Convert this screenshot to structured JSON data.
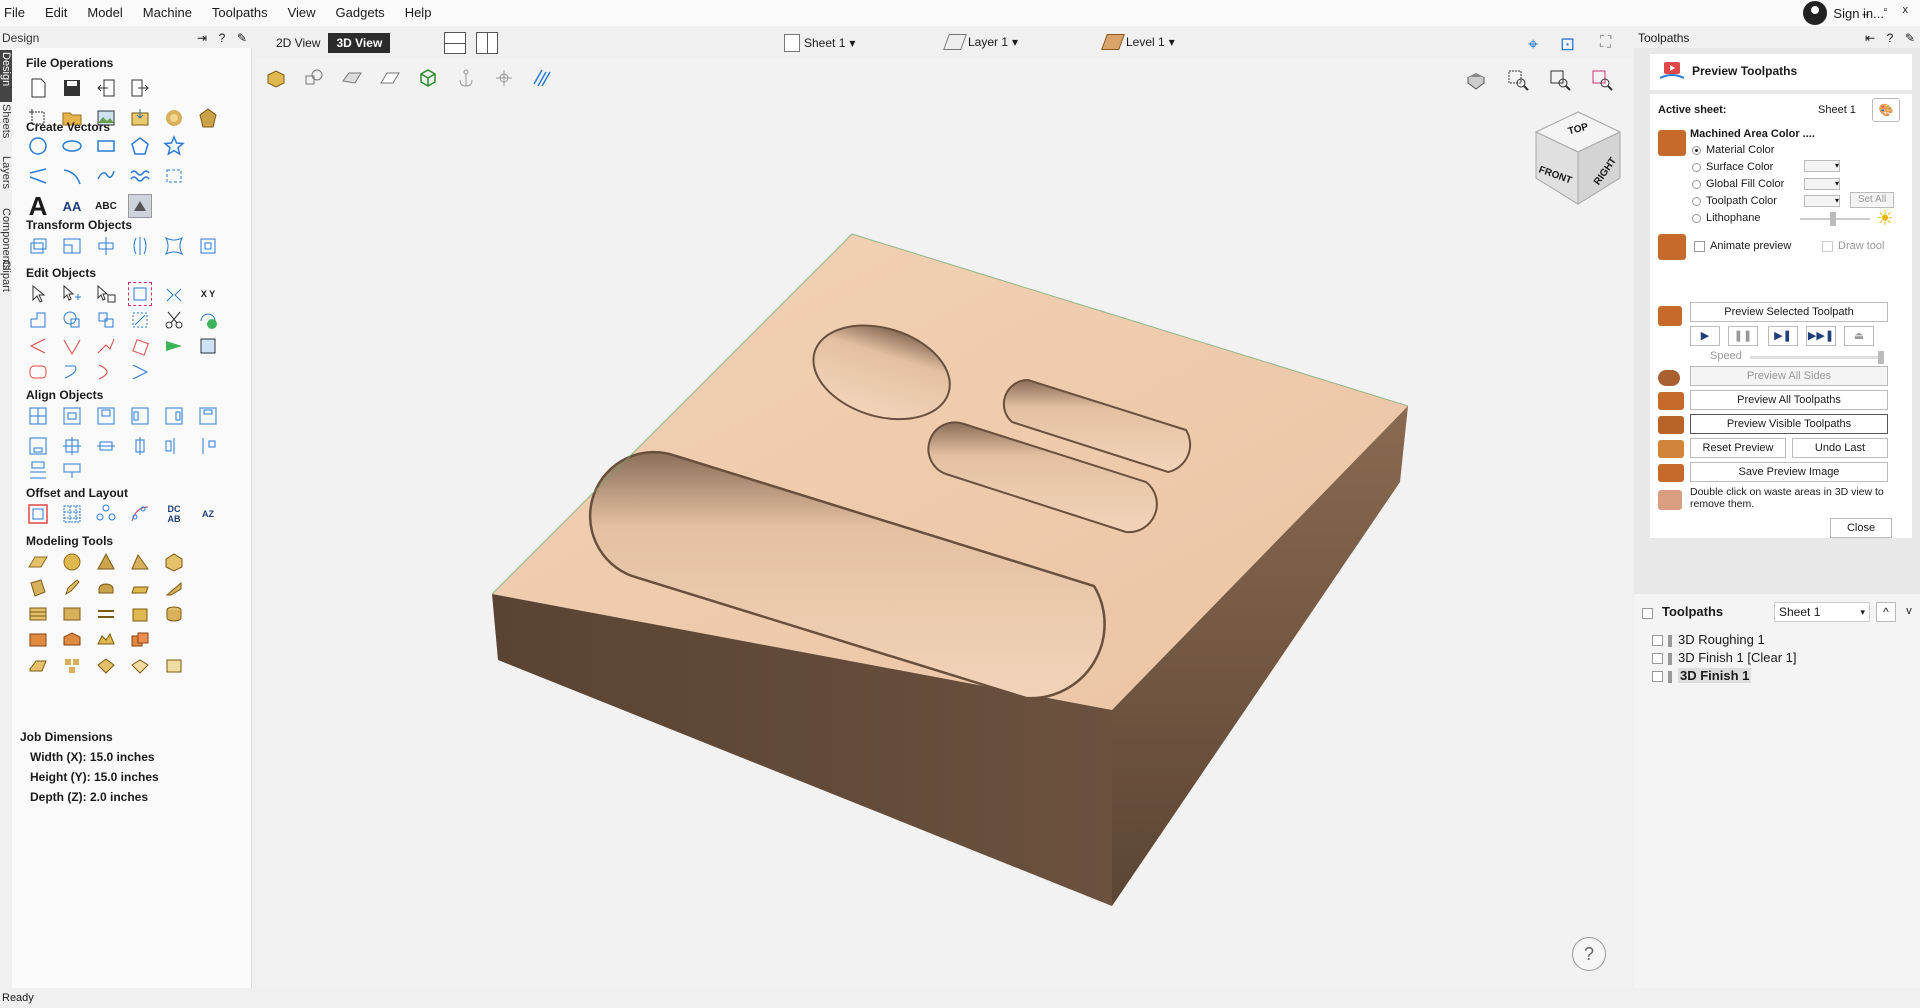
{
  "menu": [
    "File",
    "Edit",
    "Model",
    "Machine",
    "Toolpaths",
    "View",
    "Gadgets",
    "Help"
  ],
  "signin": "Sign in...",
  "window_controls": "_ ▫ x",
  "design": {
    "header": "Design",
    "side_tabs": [
      "Design",
      "Sheets",
      "Layers",
      "Components",
      "Clipart"
    ],
    "sections": {
      "file_ops": "File Operations",
      "create_vectors": "Create Vectors",
      "transform": "Transform Objects",
      "edit": "Edit Objects",
      "align": "Align Objects",
      "offset": "Offset and Layout",
      "modeling": "Modeling Tools"
    },
    "text_tools": {
      "big_a": "A",
      "small_a": "AA",
      "abc": "ABC",
      "xy": "X Y",
      "dcab": "DC AB",
      "az": "AZ"
    },
    "job": {
      "title": "Job Dimensions",
      "width": "Width  (X): 15.0 inches",
      "height": "Height (Y): 15.0 inches",
      "depth": "Depth  (Z): 2.0 inches"
    }
  },
  "view": {
    "tab_2d": "2D View",
    "tab_3d": "3D View",
    "sheet": "Sheet 1",
    "layer": "Layer 1",
    "level": "Level 1",
    "cube": {
      "top": "TOP",
      "front": "FRONT",
      "right": "RIGHT"
    },
    "help": "?"
  },
  "toolpaths_panel": {
    "header": "Toolpaths",
    "title": "Preview Toolpaths",
    "active_sheet_label": "Active sheet:",
    "active_sheet_value": "Sheet 1",
    "machined_area": "Machined Area Color ....",
    "options": [
      "Material Color",
      "Surface Color",
      "Global Fill Color",
      "Toolpath Color",
      "Lithophane"
    ],
    "set_all": "Set All",
    "animate": "Animate preview",
    "draw_tool": "Draw tool",
    "preview_selected": "Preview Selected Toolpath",
    "speed": "Speed",
    "preview_all_sides": "Preview All Sides",
    "preview_all": "Preview All Toolpaths",
    "preview_visible": "Preview Visible Toolpaths",
    "reset": "Reset Preview",
    "undo": "Undo Last",
    "save_image": "Save Preview Image",
    "hint": "Double click on waste areas in 3D view to remove them.",
    "close": "Close",
    "list_title": "Toolpaths",
    "list_sheet": "Sheet 1",
    "items": [
      "3D Roughing 1",
      "3D Finish 1 [Clear 1]",
      "3D Finish 1"
    ]
  },
  "status": "Ready"
}
